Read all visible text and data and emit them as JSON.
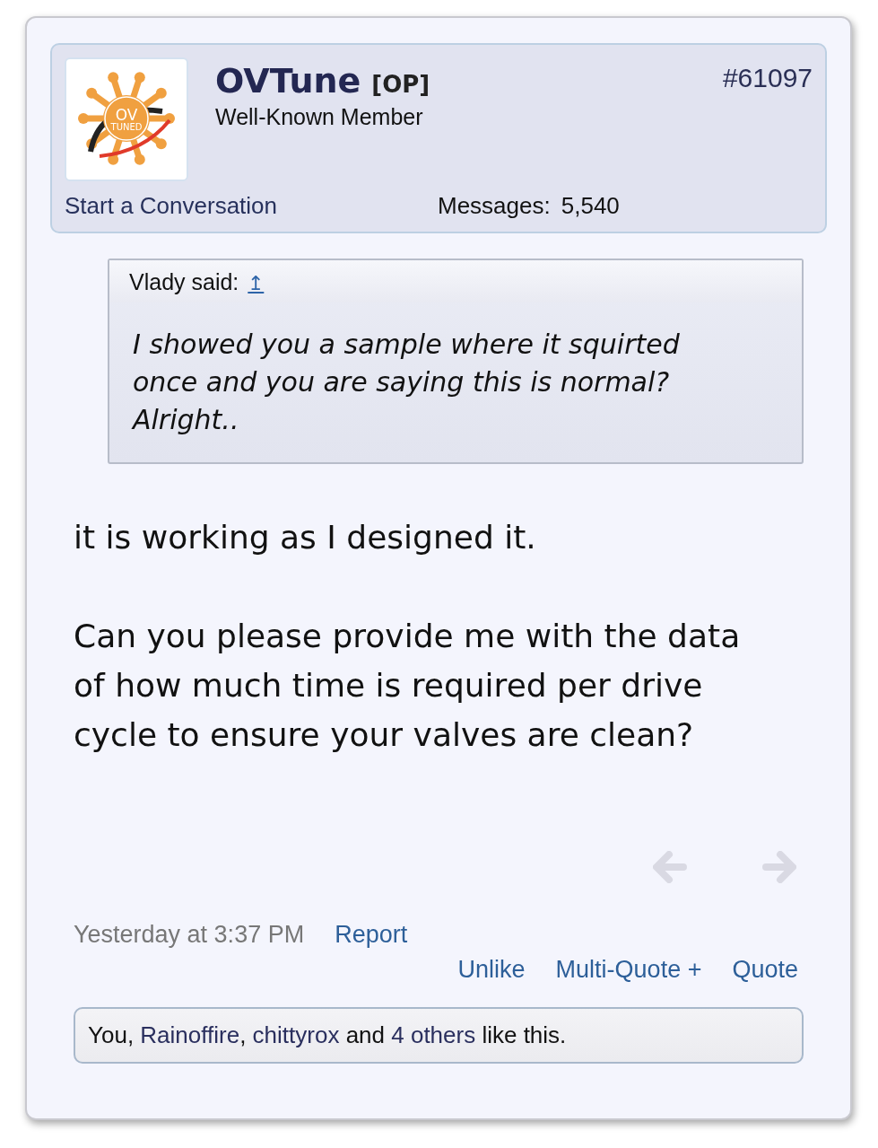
{
  "author": {
    "name": "OVTune",
    "badge": "[OP]",
    "title": "Well-Known Member",
    "logo_text": "OV",
    "logo_subtext": "TUNED"
  },
  "post_number": "#61097",
  "start_conversation": "Start a Conversation",
  "messages": {
    "label": "Messages:",
    "value": "5,540"
  },
  "quote": {
    "author": "Vlady said:",
    "jump": "↥",
    "text": "I showed you a sample where it squirted once and you are saying this is normal? Alright.."
  },
  "body": [
    "it is working as I designed it.",
    "Can you please provide me with the data of how much time is required per drive cycle to ensure your valves are clean?"
  ],
  "nav": {
    "previous_disabled": true,
    "next_disabled": true
  },
  "timestamp": "Yesterday at 3:37 PM",
  "report": "Report",
  "actions": [
    "Unlike",
    "Multi-Quote +",
    "Quote"
  ],
  "likes": [
    {
      "kind": "text",
      "text": "You, "
    },
    {
      "kind": "link",
      "text": "Rainoffire"
    },
    {
      "kind": "text",
      "text": ", "
    },
    {
      "kind": "link",
      "text": "chittyrox"
    },
    {
      "kind": "text",
      "text": " and "
    },
    {
      "kind": "link",
      "text": "4 others"
    },
    {
      "kind": "text",
      "text": " like this."
    }
  ]
}
